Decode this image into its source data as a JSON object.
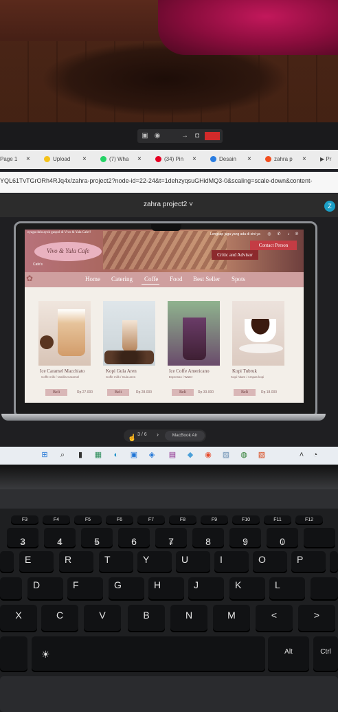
{
  "browser": {
    "tabs": [
      {
        "label": "Page 1",
        "color": "#9e9e9e"
      },
      {
        "label": "Upload",
        "color": "#f4c21a"
      },
      {
        "label": "(7) Wha",
        "color": "#25d366"
      },
      {
        "label": "(34) Pin",
        "color": "#e60023"
      },
      {
        "label": "Desain",
        "color": "#2a7de1"
      },
      {
        "label": "zahra p",
        "color": "#f24e1e"
      },
      {
        "label": "Pr",
        "color": "#333333"
      }
    ],
    "url": "YQL61TvTGrORh4RJq4x/zahra-project2?node-id=22-24&t=1dehzyqsuGHidMQ3-0&scaling=scale-down&content-"
  },
  "figma": {
    "file_title": "zahra project2",
    "avatar_letter": "Z",
    "page_indicator": "3 / 6",
    "device_label": "MacBook Air"
  },
  "site": {
    "tagline": "nyaga dulu ayok gaspol di Vivo & Yala Cafe!!",
    "logo": "Vivo & Yala Cafe",
    "logo_sub": "Cafe's",
    "follow_text": "Lengkap juga yang ada di sini ya",
    "contact_label": "Contact Person",
    "critic_label": "Critic and Advisor",
    "nav": [
      "Home",
      "Catering",
      "Coffe",
      "Food",
      "Best Seller",
      "Spots"
    ],
    "active_nav": "Coffe",
    "products": [
      {
        "name": "Ice Caramel Macchiato",
        "desc": "Coffe milk / Vanilla Caramel",
        "buy": "Beli",
        "price": "Rp 27.000"
      },
      {
        "name": "Kopi Gula Aren",
        "desc": "Coffe milk / Gula aren",
        "buy": "Beli",
        "price": "Rp 28.000"
      },
      {
        "name": "Ice Coffe Americano",
        "desc": "Espresso / Water",
        "buy": "Beli",
        "price": "Rp 33.000"
      },
      {
        "name": "Kopi Tubruk",
        "desc": "Kopi hitam / Ampas kopi",
        "buy": "Beli",
        "price": "Rp 18.000"
      }
    ]
  },
  "keyboard": {
    "fn_row": [
      "F3",
      "F4",
      "F5",
      "F6",
      "F7",
      "F8",
      "F9",
      "F10",
      "F11",
      "F12"
    ],
    "num_row": [
      {
        "main": "3",
        "sub": "#"
      },
      {
        "main": "4",
        "sub": "$"
      },
      {
        "main": "5",
        "sub": "%"
      },
      {
        "main": "6",
        "sub": "^"
      },
      {
        "main": "7",
        "sub": "&"
      },
      {
        "main": "8",
        "sub": "*"
      },
      {
        "main": "9",
        "sub": "("
      },
      {
        "main": "0",
        "sub": ")"
      }
    ],
    "row_q": [
      "E",
      "R",
      "T",
      "Y",
      "U",
      "I",
      "O",
      "P"
    ],
    "row_a": [
      "D",
      "F",
      "G",
      "H",
      "J",
      "K",
      "L"
    ],
    "row_z": [
      "X",
      "C",
      "V",
      "B",
      "N",
      "M",
      "<",
      ">"
    ],
    "bottom": {
      "alt": "Alt",
      "ctrl": "Ctrl"
    }
  }
}
